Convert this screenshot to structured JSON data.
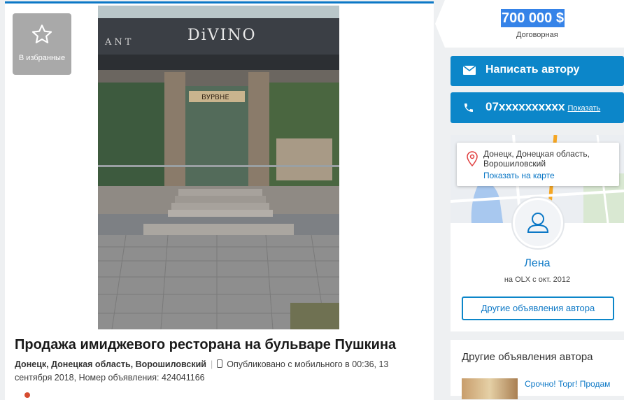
{
  "favorite": {
    "label": "В избранные",
    "icon": "star-icon"
  },
  "photo": {
    "sign_brand": "DiVINO",
    "sign_side": "ANT",
    "banner": "ВУРВНЕ"
  },
  "ad": {
    "title": "Продажа имиджевого ресторана на бульваре Пушкина",
    "location": "Донецк, Донецкая область, Ворошиловский",
    "published": "Опубликовано с мобильного",
    "time": "в 00:36, 13",
    "date_tail": "сентября 2018, Номер объявления: 424041166"
  },
  "price": {
    "value": "700 000 $",
    "note": "Договорная"
  },
  "contact": {
    "message_label": "Написать автору",
    "phone": "07xxxxxxxxxx",
    "phone_show": "Показать"
  },
  "location_card": {
    "address": "Донецк, Донецкая область, Ворошиловский",
    "map_link": "Показать на карте"
  },
  "user": {
    "name": "Лена",
    "since": "на OLX с окт. 2012",
    "other_ads_button": "Другие объявления автора"
  },
  "other_ads": {
    "title": "Другие объявления автора",
    "first_item": "Срочно! Торг! Продам"
  },
  "colors": {
    "accent": "#0c86c9",
    "link": "#0c78c6",
    "highlight": "#3583e8",
    "panel": "#ffffff",
    "page": "#eef0f2"
  }
}
